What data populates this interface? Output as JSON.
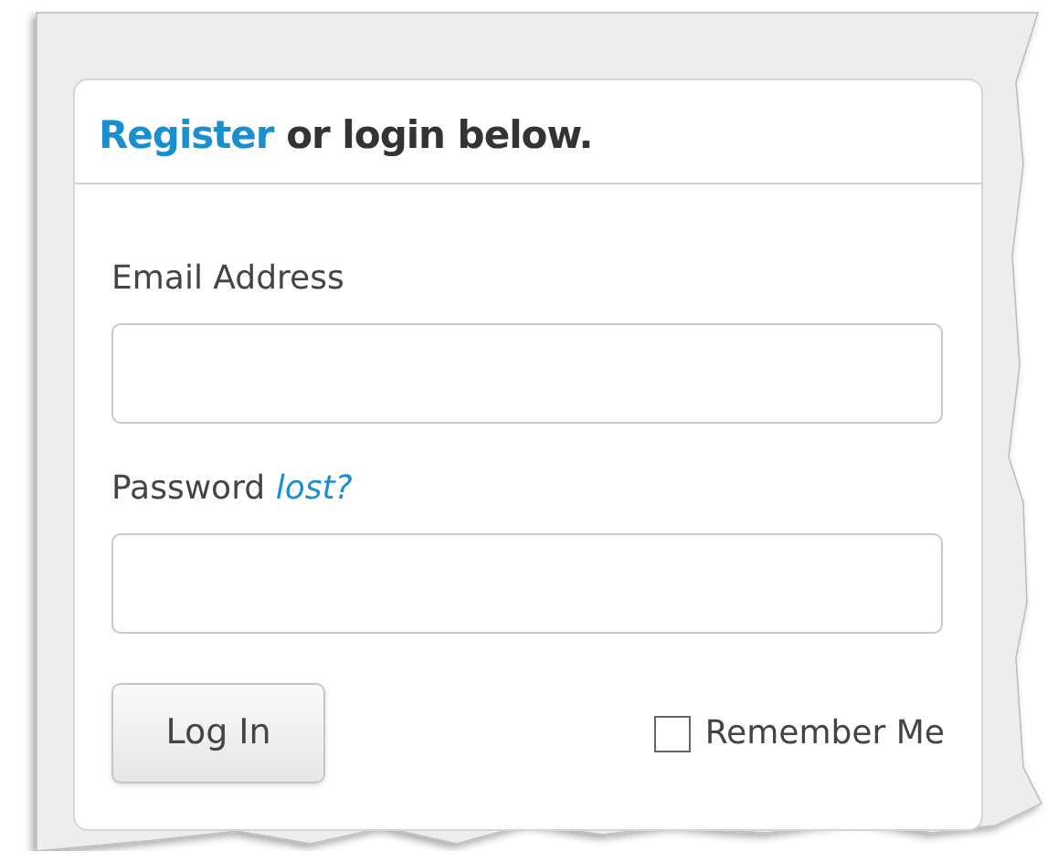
{
  "panel": {
    "heading": {
      "link": "Register",
      "text": "or login below."
    },
    "email": {
      "label": "Email Address"
    },
    "password": {
      "label": "Password",
      "link": "lost?"
    },
    "login_button": "Log In",
    "remember": {
      "label": "Remember Me",
      "checked": false
    }
  }
}
